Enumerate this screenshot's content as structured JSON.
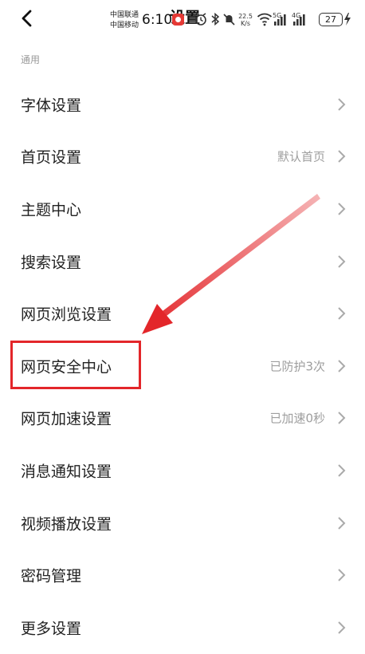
{
  "status_bar": {
    "carrier_1": "中国联通",
    "carrier_2": "中国移动",
    "time": "6:10",
    "net_speed_value": "22.5",
    "net_speed_unit": "K/s",
    "signal_1_label": "5G",
    "signal_2_label": "4G",
    "battery": "27",
    "icons": [
      "record-icon",
      "alarm-icon",
      "bluetooth-icon",
      "mute-icon",
      "wifi-icon",
      "signal-icon",
      "signal-icon",
      "battery-icon",
      "charging-icon"
    ]
  },
  "header": {
    "title": "设置",
    "back_icon": "chevron-left-icon"
  },
  "section": {
    "label": "通用"
  },
  "items": [
    {
      "label": "字体设置",
      "value": ""
    },
    {
      "label": "首页设置",
      "value": "默认首页"
    },
    {
      "label": "主题中心",
      "value": ""
    },
    {
      "label": "搜索设置",
      "value": ""
    },
    {
      "label": "网页浏览设置",
      "value": ""
    },
    {
      "label": "网页安全中心",
      "value": "已防护3次"
    },
    {
      "label": "网页加速设置",
      "value": "已加速0秒"
    },
    {
      "label": "消息通知设置",
      "value": ""
    },
    {
      "label": "视频播放设置",
      "value": ""
    },
    {
      "label": "密码管理",
      "value": ""
    },
    {
      "label": "更多设置",
      "value": ""
    }
  ],
  "annotation": {
    "color": "#e3262a",
    "highlighted_item": "网页安全中心"
  }
}
